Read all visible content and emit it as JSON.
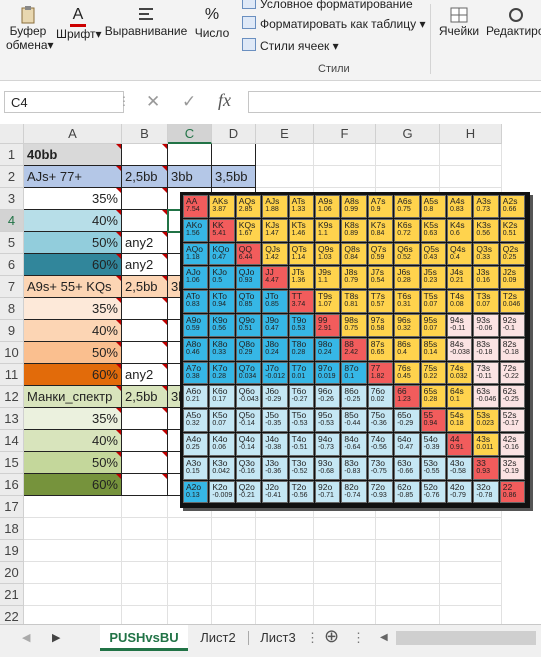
{
  "ribbon": {
    "clipboard": {
      "label_line1": "Буфер",
      "label_line2": "обмена",
      "dropdown": "▾"
    },
    "font": {
      "label": "Шрифт",
      "icon_text": "A",
      "dropdown": "▾"
    },
    "alignment": {
      "label": "Выравнивание"
    },
    "number": {
      "label": "Число",
      "icon_text": "%"
    },
    "styles": {
      "conditional": "Условное форматирование",
      "as_table": "Форматировать как таблицу",
      "cell_styles": "Стили ячеек",
      "group_label": "Стили"
    },
    "cells": {
      "label": "Ячейки"
    },
    "editing": {
      "label": "Редактиро"
    }
  },
  "formula_bar": {
    "name_box": "C4",
    "cancel_icon": "✕",
    "enter_icon": "✓",
    "fx_label": "fx",
    "formula": ""
  },
  "columns": [
    "A",
    "B",
    "C",
    "D",
    "E",
    "F",
    "G",
    "H"
  ],
  "rows": [
    {
      "n": "1",
      "a": "40bb",
      "b": "",
      "c": "",
      "d": ""
    },
    {
      "n": "2",
      "a": "AJs+ 77+",
      "b": "2,5bb",
      "c": "3bb",
      "d": "3,5bb"
    },
    {
      "n": "3",
      "a": "35%",
      "b": "",
      "c": "",
      "d": ""
    },
    {
      "n": "4",
      "a": "40%",
      "b": "",
      "c": "",
      "d": ""
    },
    {
      "n": "5",
      "a": "50%",
      "b": "any2",
      "c": "",
      "d": ""
    },
    {
      "n": "6",
      "a": "60%",
      "b": "any2",
      "c": "",
      "d": ""
    },
    {
      "n": "7",
      "a": "A9s+ 55+ KQs",
      "b": "2,5bb",
      "c": "3b",
      "d": ""
    },
    {
      "n": "8",
      "a": "35%",
      "b": "",
      "c": "",
      "d": ""
    },
    {
      "n": "9",
      "a": "40%",
      "b": "",
      "c": "",
      "d": ""
    },
    {
      "n": "10",
      "a": "50%",
      "b": "",
      "c": "",
      "d": ""
    },
    {
      "n": "11",
      "a": "60%",
      "b": "any2",
      "c": "",
      "d": ""
    },
    {
      "n": "12",
      "a": "Манки_спектр",
      "b": "2,5bb",
      "c": "3b",
      "d": ""
    },
    {
      "n": "13",
      "a": "35%",
      "b": "",
      "c": "",
      "d": ""
    },
    {
      "n": "14",
      "a": "40%",
      "b": "",
      "c": "",
      "d": ""
    },
    {
      "n": "15",
      "a": "50%",
      "b": "",
      "c": "",
      "d": ""
    },
    {
      "n": "16",
      "a": "60%",
      "b": "",
      "c": "",
      "d": ""
    },
    {
      "n": "17",
      "a": "",
      "b": "",
      "c": "",
      "d": ""
    },
    {
      "n": "18",
      "a": "",
      "b": "",
      "c": "",
      "d": ""
    },
    {
      "n": "19",
      "a": "",
      "b": "",
      "c": "",
      "d": ""
    },
    {
      "n": "20",
      "a": "",
      "b": "",
      "c": "",
      "d": ""
    },
    {
      "n": "21",
      "a": "",
      "b": "",
      "c": "",
      "d": ""
    },
    {
      "n": "22",
      "a": "",
      "b": "",
      "c": "",
      "d": ""
    },
    {
      "n": "23",
      "a": "",
      "b": "",
      "c": "",
      "d": ""
    }
  ],
  "row_fills": {
    "1": "#d9d9d9",
    "2": "#b4c7e7",
    "3": "#ffffff",
    "4": "#b7dee8",
    "5": "#92cddc",
    "6": "#31869b",
    "7": "#fcd5b4",
    "8": "#fde9d9",
    "9": "#fcd5b4",
    "10": "#fabf8f",
    "11": "#e26b0a",
    "12": "#d8e4bc",
    "13": "#ebf1de",
    "14": "#d8e4bc",
    "15": "#c4d79b",
    "16": "#76933c"
  },
  "matrix": {
    "hands": [
      [
        "AA",
        "AKs",
        "AQs",
        "AJs",
        "ATs",
        "A9s",
        "A8s",
        "A7s",
        "A6s",
        "A5s",
        "A4s",
        "A3s",
        "A2s"
      ],
      [
        "AKo",
        "KK",
        "KQs",
        "KJs",
        "KTs",
        "K9s",
        "K8s",
        "K7s",
        "K6s",
        "K5s",
        "K4s",
        "K3s",
        "K2s"
      ],
      [
        "AQo",
        "KQo",
        "QQ",
        "QJs",
        "QTs",
        "Q9s",
        "Q8s",
        "Q7s",
        "Q6s",
        "Q5s",
        "Q4s",
        "Q3s",
        "Q2s"
      ],
      [
        "AJo",
        "KJo",
        "QJo",
        "JJ",
        "JTs",
        "J9s",
        "J8s",
        "J7s",
        "J6s",
        "J5s",
        "J4s",
        "J3s",
        "J2s"
      ],
      [
        "ATo",
        "KTo",
        "QTo",
        "JTo",
        "TT",
        "T9s",
        "T8s",
        "T7s",
        "T6s",
        "T5s",
        "T4s",
        "T3s",
        "T2s"
      ],
      [
        "A9o",
        "K9o",
        "Q9o",
        "J9o",
        "T9o",
        "99",
        "98s",
        "97s",
        "96s",
        "95s",
        "94s",
        "93s",
        "92s"
      ],
      [
        "A8o",
        "K8o",
        "Q8o",
        "J8o",
        "T8o",
        "98o",
        "88",
        "87s",
        "86s",
        "85s",
        "84s",
        "83s",
        "82s"
      ],
      [
        "A7o",
        "K7o",
        "Q7o",
        "J7o",
        "T7o",
        "97o",
        "87o",
        "77",
        "76s",
        "75s",
        "74s",
        "73s",
        "72s"
      ],
      [
        "A6o",
        "K6o",
        "Q6o",
        "J6o",
        "T6o",
        "96o",
        "86o",
        "76o",
        "66",
        "65s",
        "64s",
        "63s",
        "62s"
      ],
      [
        "A5o",
        "K5o",
        "Q5o",
        "J5o",
        "T5o",
        "95o",
        "85o",
        "75o",
        "65o",
        "55",
        "54s",
        "53s",
        "52s"
      ],
      [
        "A4o",
        "K4o",
        "Q4o",
        "J4o",
        "T4o",
        "94o",
        "84o",
        "74o",
        "64o",
        "54o",
        "44",
        "43s",
        "42s"
      ],
      [
        "A3o",
        "K3o",
        "Q3o",
        "J3o",
        "T3o",
        "93o",
        "83o",
        "73o",
        "63o",
        "53o",
        "43o",
        "33",
        "32s"
      ],
      [
        "A2o",
        "K2o",
        "Q2o",
        "J2o",
        "T2o",
        "92o",
        "82o",
        "72o",
        "62o",
        "52o",
        "42o",
        "32o",
        "22"
      ]
    ],
    "values": [
      [
        "7.54",
        "3.87",
        "2.85",
        "1.88",
        "1.33",
        "1.06",
        "0.99",
        "0.9",
        "0.75",
        "0.8",
        "0.83",
        "0.73",
        "0.66"
      ],
      [
        "1.56",
        "5.41",
        "1.67",
        "1.47",
        "1.46",
        "1.1",
        "0.89",
        "0.84",
        "0.72",
        "0.63",
        "0.6",
        "0.56",
        "0.51"
      ],
      [
        "1.18",
        "0.47",
        "6.44",
        "1.42",
        "1.14",
        "1.03",
        "0.84",
        "0.59",
        "0.52",
        "0.43",
        "0.4",
        "0.33",
        "0.25"
      ],
      [
        "1.06",
        "0.5",
        "0.93",
        "4.47",
        "1.36",
        "1.1",
        "0.79",
        "0.54",
        "0.28",
        "0.23",
        "0.21",
        "0.16",
        "0.09"
      ],
      [
        "0.83",
        "0.94",
        "0.85",
        "0.85",
        "3.74",
        "1.07",
        "0.81",
        "0.57",
        "0.31",
        "0.07",
        "0.08",
        "0.07",
        "0.046"
      ],
      [
        "0.59",
        "0.56",
        "0.51",
        "0.47",
        "0.53",
        "2.91",
        "0.75",
        "0.58",
        "0.32",
        "0.07",
        "-0.11",
        "-0.06",
        "-0.1"
      ],
      [
        "0.46",
        "0.33",
        "0.29",
        "0.24",
        "0.28",
        "0.24",
        "2.42",
        "0.65",
        "0.4",
        "0.14",
        "-0.038",
        "-0.18",
        "-0.18"
      ],
      [
        "0.38",
        "0.28",
        "0.034",
        "-0.012",
        "0.01",
        "0.019",
        "0.1",
        "1.82",
        "0.45",
        "0.22",
        "0.032",
        "-0.11",
        "-0.22"
      ],
      [
        "0.21",
        "0.17",
        "-0.043",
        "-0.29",
        "-0.27",
        "-0.26",
        "-0.25",
        "0.02",
        "1.23",
        "0.28",
        "0.1",
        "-0.046",
        "-0.25"
      ],
      [
        "0.32",
        "0.07",
        "-0.14",
        "-0.35",
        "-0.53",
        "-0.53",
        "-0.44",
        "-0.36",
        "-0.29",
        "0.94",
        "0.18",
        "0.023",
        "-0.17"
      ],
      [
        "0.25",
        "0.06",
        "-0.14",
        "-0.38",
        "-0.51",
        "-0.73",
        "-0.64",
        "-0.56",
        "-0.47",
        "-0.39",
        "0.91",
        "0.011",
        "-0.16"
      ],
      [
        "0.15",
        "0.042",
        "-0.16",
        "-0.36",
        "-0.52",
        "-0.68",
        "-0.83",
        "-0.75",
        "-0.66",
        "-0.55",
        "-0.58",
        "0.93",
        "-0.19"
      ],
      [
        "0.13",
        "-0.009",
        "-0.21",
        "-0.41",
        "-0.56",
        "-0.71",
        "-0.74",
        "-0.93",
        "-0.85",
        "-0.76",
        "-0.79",
        "-0.78",
        "0.86"
      ]
    ],
    "categories": [
      [
        "r",
        "y",
        "y",
        "y",
        "y",
        "y",
        "y",
        "y",
        "y",
        "y",
        "y",
        "y",
        "y"
      ],
      [
        "c",
        "r",
        "y",
        "y",
        "y",
        "y",
        "y",
        "y",
        "y",
        "y",
        "y",
        "y",
        "y"
      ],
      [
        "c",
        "c",
        "r",
        "y",
        "y",
        "y",
        "y",
        "y",
        "y",
        "y",
        "y",
        "y",
        "y"
      ],
      [
        "c",
        "c",
        "c",
        "r",
        "y",
        "y",
        "y",
        "y",
        "y",
        "y",
        "y",
        "y",
        "y"
      ],
      [
        "c",
        "c",
        "c",
        "c",
        "r",
        "y",
        "y",
        "y",
        "y",
        "y",
        "y",
        "y",
        "y"
      ],
      [
        "c",
        "c",
        "c",
        "c",
        "c",
        "r",
        "y",
        "y",
        "y",
        "y",
        "l",
        "l",
        "l"
      ],
      [
        "c",
        "c",
        "c",
        "c",
        "c",
        "c",
        "r",
        "y",
        "y",
        "y",
        "l",
        "l",
        "l"
      ],
      [
        "c",
        "c",
        "c",
        "c",
        "c",
        "c",
        "c",
        "r",
        "y",
        "y",
        "y",
        "l",
        "l"
      ],
      [
        "p",
        "p",
        "p",
        "p",
        "p",
        "p",
        "p",
        "p",
        "r",
        "y",
        "y",
        "l",
        "l"
      ],
      [
        "p",
        "p",
        "p",
        "p",
        "p",
        "p",
        "p",
        "p",
        "p",
        "r",
        "y",
        "y",
        "l"
      ],
      [
        "p",
        "p",
        "p",
        "p",
        "p",
        "p",
        "p",
        "p",
        "p",
        "p",
        "r",
        "y",
        "l"
      ],
      [
        "p",
        "p",
        "p",
        "p",
        "p",
        "p",
        "p",
        "p",
        "p",
        "p",
        "p",
        "r",
        "l"
      ],
      [
        "c",
        "p",
        "p",
        "p",
        "p",
        "p",
        "p",
        "p",
        "p",
        "p",
        "p",
        "p",
        "r"
      ]
    ],
    "colors": {
      "r": "#f25c5c",
      "y": "#ffd34d",
      "c": "#36b7e6",
      "p": "#c5e7f4",
      "l": "#fbe3e3"
    }
  },
  "sheets": {
    "tabs": [
      "PUSHvsBU",
      "Лист2",
      "Лист3"
    ],
    "active": "PUSHvsBU",
    "add_icon": "⊕",
    "menu_icon": "⋮"
  }
}
